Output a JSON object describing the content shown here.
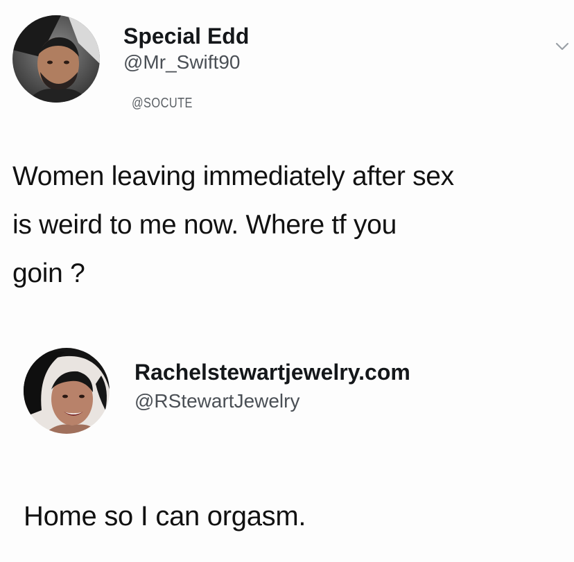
{
  "tweet": {
    "author_name": "Special Edd",
    "author_handle": "@Mr_Swift90",
    "watermark": "@SOCUTE",
    "avatar_icon": "profile-photo-man",
    "menu_icon": "chevron-down-icon",
    "text_lines": [
      "Women leaving immediately after sex",
      "is weird to me now. Where tf you",
      "goin ?"
    ]
  },
  "reply": {
    "author_name": "Rachelstewartjewelry.com",
    "author_handle": "@RStewartJewelry",
    "avatar_icon": "profile-photo-woman",
    "text": "Home so I can orgasm."
  }
}
